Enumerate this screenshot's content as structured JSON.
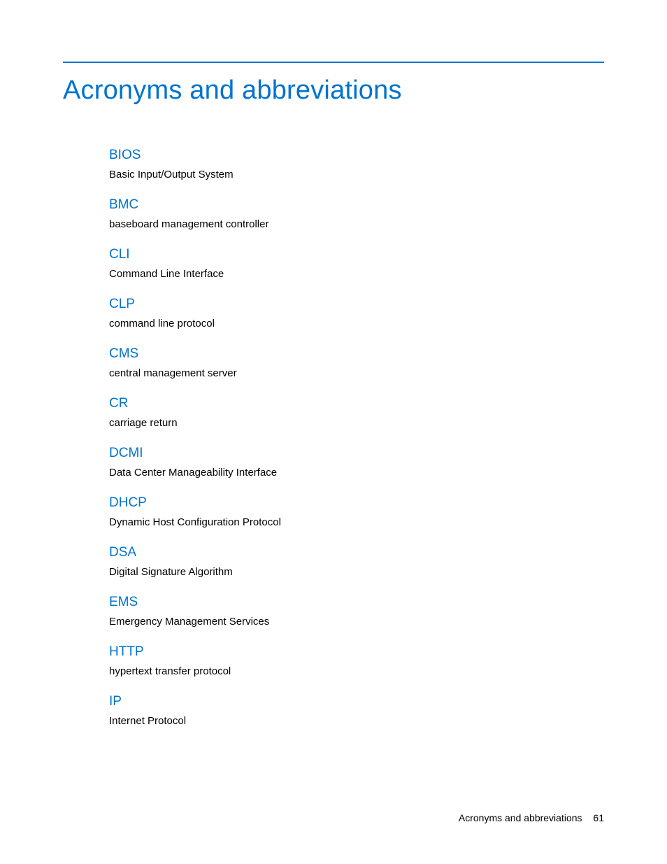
{
  "title": "Acronyms and abbreviations",
  "entries": [
    {
      "term": "BIOS",
      "definition": "Basic Input/Output System"
    },
    {
      "term": "BMC",
      "definition": "baseboard management controller"
    },
    {
      "term": "CLI",
      "definition": "Command Line Interface"
    },
    {
      "term": "CLP",
      "definition": "command line protocol"
    },
    {
      "term": "CMS",
      "definition": "central management server"
    },
    {
      "term": "CR",
      "definition": "carriage return"
    },
    {
      "term": "DCMI",
      "definition": "Data Center Manageability Interface"
    },
    {
      "term": "DHCP",
      "definition": "Dynamic Host Configuration Protocol"
    },
    {
      "term": "DSA",
      "definition": "Digital Signature Algorithm"
    },
    {
      "term": "EMS",
      "definition": "Emergency Management Services"
    },
    {
      "term": "HTTP",
      "definition": "hypertext transfer protocol"
    },
    {
      "term": "IP",
      "definition": "Internet Protocol"
    }
  ],
  "footer": {
    "section": "Acronyms and abbreviations",
    "page": "61"
  }
}
